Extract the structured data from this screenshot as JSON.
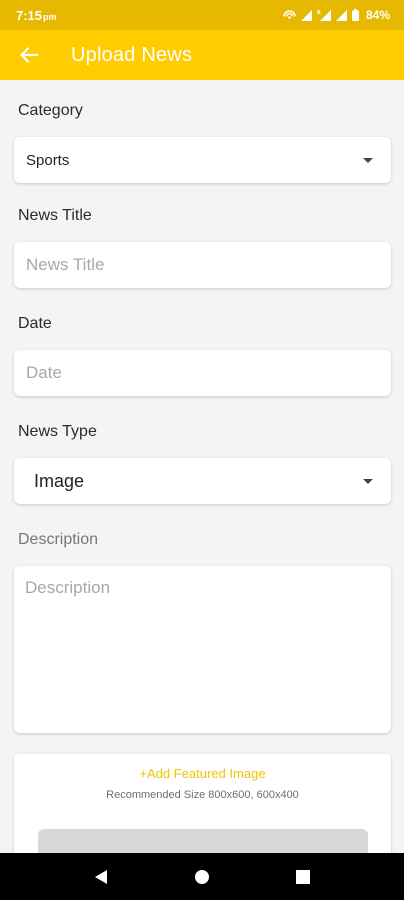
{
  "status_bar": {
    "time": "7:15",
    "ampm": "pm",
    "battery": "84%"
  },
  "app_bar": {
    "title": "Upload News",
    "back_icon": "arrow-left-icon"
  },
  "form": {
    "category": {
      "label": "Category",
      "value": "Sports"
    },
    "news_title": {
      "label": "News Title",
      "placeholder": "News Title"
    },
    "date": {
      "label": "Date",
      "placeholder": "Date"
    },
    "news_type": {
      "label": "News Type",
      "value": "Image"
    },
    "description": {
      "label": "Description",
      "placeholder": "Description"
    },
    "featured_image": {
      "add_label": "+Add Featured Image",
      "recommended": "Recommended Size 800x600, 600x400"
    }
  },
  "colors": {
    "status_bar": "#e6b800",
    "app_bar": "#ffcc00",
    "accent_text": "#f2c300",
    "background": "#f4f4f4"
  },
  "nav_bar": {
    "icons": [
      "back-triangle-icon",
      "home-circle-icon",
      "recents-square-icon"
    ]
  }
}
